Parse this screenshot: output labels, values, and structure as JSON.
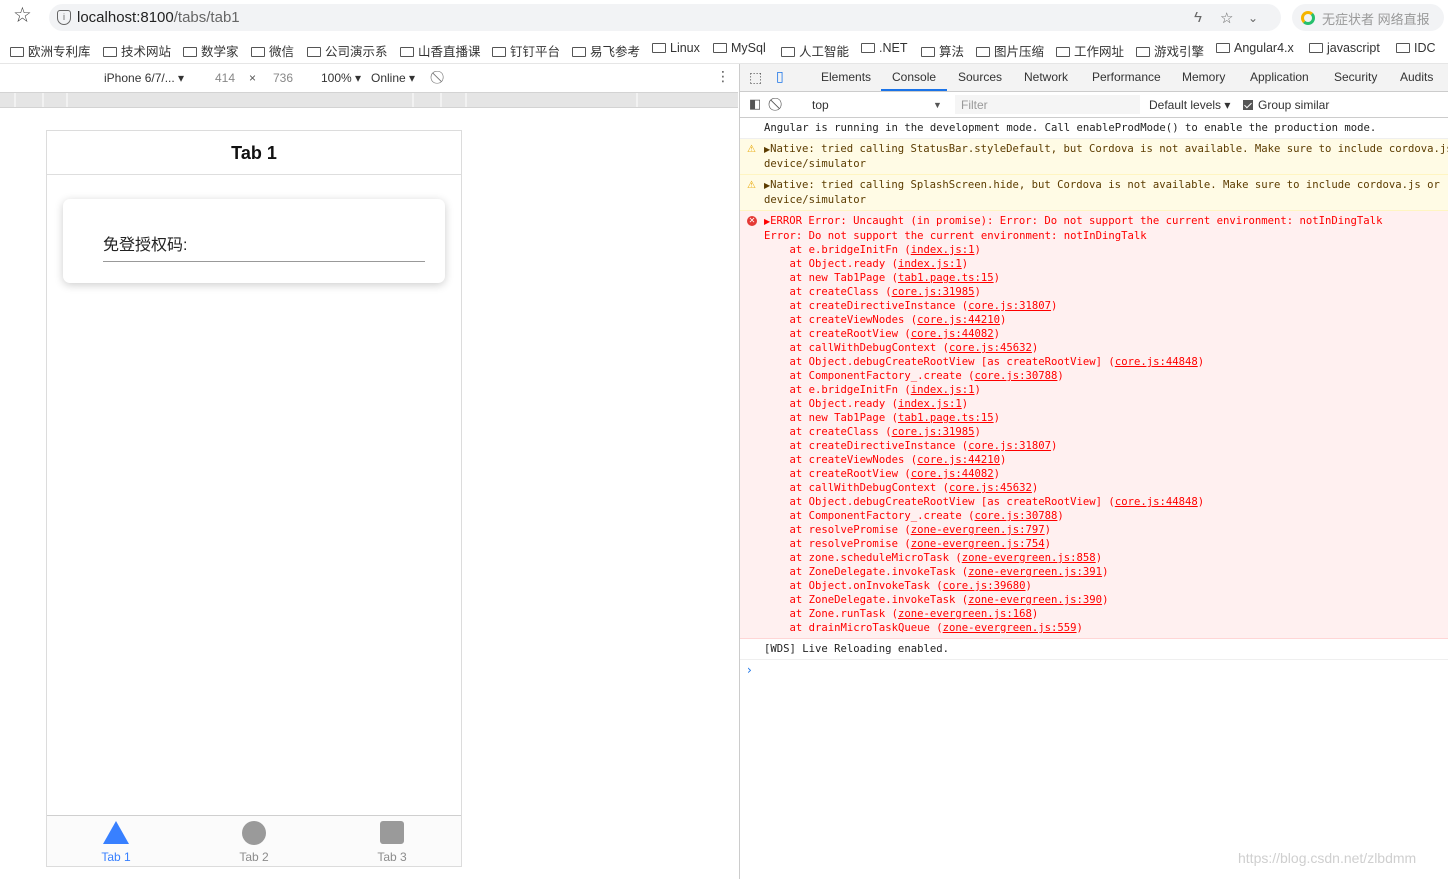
{
  "browser": {
    "url_host": "localhost:8100",
    "url_path": "/tabs/tab1",
    "extension_text": "无症状者 网络直报",
    "bookmarks": [
      "欧洲专利库",
      "技术网站",
      "数学家",
      "微信",
      "公司演示系",
      "山香直播课",
      "钉钉平台",
      "易飞参考",
      "Linux",
      "MySql",
      "人工智能",
      ".NET",
      "算法",
      "图片压缩",
      "工作网址",
      "游戏引擎",
      "Angular4.x",
      "javascript",
      "IDC"
    ]
  },
  "device_toolbar": {
    "device": "iPhone 6/7/...",
    "width": "414",
    "times": "×",
    "height": "736",
    "zoom": "100%",
    "network": "Online"
  },
  "app": {
    "header_title": "Tab 1",
    "card_label": "免登授权码:",
    "tabs": [
      {
        "label": "Tab 1",
        "icon": "triangle-icon",
        "active": true,
        "color": "#3880ff"
      },
      {
        "label": "Tab 2",
        "icon": "circle-icon",
        "active": false
      },
      {
        "label": "Tab 3",
        "icon": "square-icon",
        "active": false
      }
    ]
  },
  "devtools": {
    "tabs": [
      "Elements",
      "Console",
      "Sources",
      "Network",
      "Performance",
      "Memory",
      "Application",
      "Security",
      "Audits"
    ],
    "active_tab": "Console",
    "context": "top",
    "filter_placeholder": "Filter",
    "levels": "Default levels",
    "group_similar": "Group similar"
  },
  "console": {
    "info1": "Angular is running in the development mode. Call enableProdMode() to enable the production mode.",
    "warn1_a": "Native: tried calling StatusBar.styleDefault, but Cordova is not available. Make sure to include cordova.js or run in a",
    "warn1_b": "device/simulator",
    "warn2_a": "Native: tried calling SplashScreen.hide, but Cordova is not available. Make sure to include cordova.js or run in a",
    "warn2_b": "device/simulator",
    "error_head": "ERROR Error: Uncaught (in promise): Error: Do not support the current environment: notInDingTalk",
    "error_sub": "Error: Do not support the current environment: notInDingTalk",
    "stack": [
      {
        "fn": "e.bridgeInitFn",
        "src": "index.js:1"
      },
      {
        "fn": "Object.ready",
        "src": "index.js:1"
      },
      {
        "fn": "new Tab1Page",
        "src": "tab1.page.ts:15"
      },
      {
        "fn": "createClass",
        "src": "core.js:31985"
      },
      {
        "fn": "createDirectiveInstance",
        "src": "core.js:31807"
      },
      {
        "fn": "createViewNodes",
        "src": "core.js:44210"
      },
      {
        "fn": "createRootView",
        "src": "core.js:44082"
      },
      {
        "fn": "callWithDebugContext",
        "src": "core.js:45632"
      },
      {
        "fn": "Object.debugCreateRootView [as createRootView]",
        "src": "core.js:44848"
      },
      {
        "fn": "ComponentFactory_.create",
        "src": "core.js:30788"
      },
      {
        "fn": "e.bridgeInitFn",
        "src": "index.js:1"
      },
      {
        "fn": "Object.ready",
        "src": "index.js:1"
      },
      {
        "fn": "new Tab1Page",
        "src": "tab1.page.ts:15"
      },
      {
        "fn": "createClass",
        "src": "core.js:31985"
      },
      {
        "fn": "createDirectiveInstance",
        "src": "core.js:31807"
      },
      {
        "fn": "createViewNodes",
        "src": "core.js:44210"
      },
      {
        "fn": "createRootView",
        "src": "core.js:44082"
      },
      {
        "fn": "callWithDebugContext",
        "src": "core.js:45632"
      },
      {
        "fn": "Object.debugCreateRootView [as createRootView]",
        "src": "core.js:44848"
      },
      {
        "fn": "ComponentFactory_.create",
        "src": "core.js:30788"
      },
      {
        "fn": "resolvePromise",
        "src": "zone-evergreen.js:797"
      },
      {
        "fn": "resolvePromise",
        "src": "zone-evergreen.js:754"
      },
      {
        "fn": "zone.scheduleMicroTask",
        "src": "zone-evergreen.js:858"
      },
      {
        "fn": "ZoneDelegate.invokeTask",
        "src": "zone-evergreen.js:391"
      },
      {
        "fn": "Object.onInvokeTask",
        "src": "core.js:39680"
      },
      {
        "fn": "ZoneDelegate.invokeTask",
        "src": "zone-evergreen.js:390"
      },
      {
        "fn": "Zone.runTask",
        "src": "zone-evergreen.js:168"
      },
      {
        "fn": "drainMicroTaskQueue",
        "src": "zone-evergreen.js:559"
      }
    ],
    "info2": "[WDS] Live Reloading enabled."
  },
  "watermark": "https://blog.csdn.net/zlbdmm"
}
